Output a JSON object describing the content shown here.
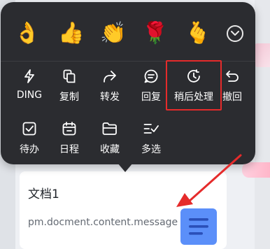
{
  "popup": {
    "emojis": [
      {
        "icon": "ok-hand-emoji",
        "glyph": "👌"
      },
      {
        "icon": "thumbs-up-emoji",
        "glyph": "👍"
      },
      {
        "icon": "clapping-hands-emoji",
        "glyph": "👏"
      },
      {
        "icon": "hand-with-flower-emoji",
        "glyph": "🌹"
      },
      {
        "icon": "finger-heart-emoji",
        "glyph": "🫰"
      }
    ],
    "expand_icon": "chevron-down-circle-icon",
    "actions": [
      {
        "label": "DING",
        "icon": "lightning-icon"
      },
      {
        "label": "复制",
        "icon": "copy-icon"
      },
      {
        "label": "转发",
        "icon": "forward-icon"
      },
      {
        "label": "回复",
        "icon": "reply-bubble-icon"
      },
      {
        "label": "稍后处理",
        "icon": "clock-refresh-icon"
      },
      {
        "label": "撤回",
        "icon": "undo-icon"
      },
      {
        "label": "待办",
        "icon": "checkbox-icon"
      },
      {
        "label": "日程",
        "icon": "calendar-icon"
      },
      {
        "label": "收藏",
        "icon": "folder-icon"
      },
      {
        "label": "多选",
        "icon": "multi-select-icon"
      }
    ]
  },
  "document": {
    "title": "文档1",
    "description": "pm.docment.content.message",
    "icon": "document-lines-icon"
  },
  "colors": {
    "popup_bg": "#2b2c30",
    "highlight": "#e52b2b",
    "doc_icon_bg": "#5b8ff9"
  }
}
